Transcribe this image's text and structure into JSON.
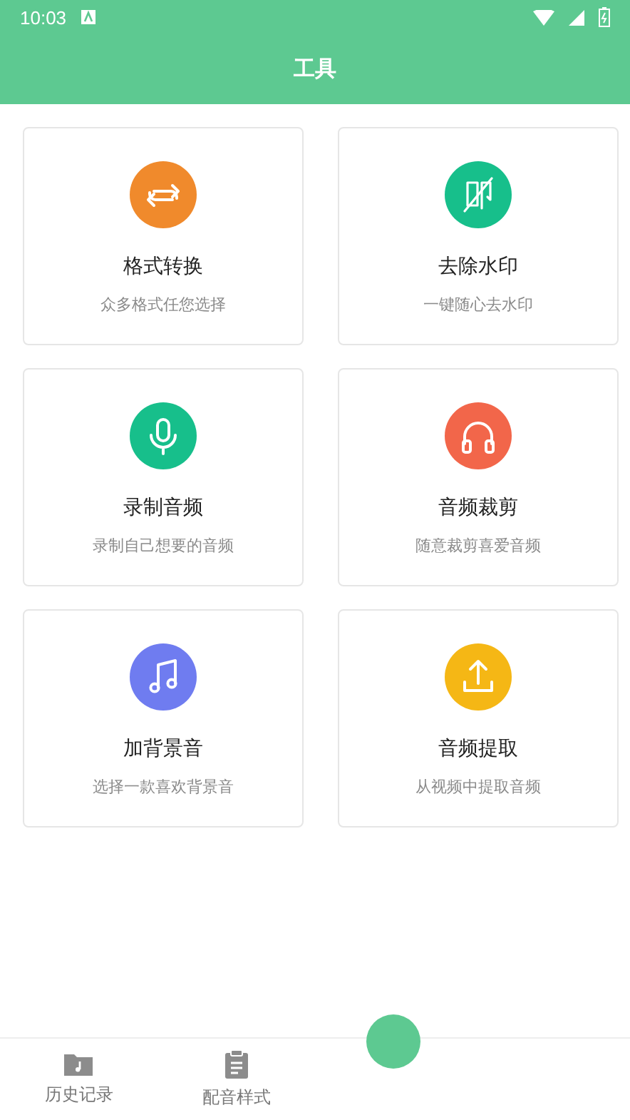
{
  "status_bar": {
    "time": "10:03"
  },
  "header": {
    "title": "工具"
  },
  "tools": [
    {
      "kind": "convert",
      "title": "格式转换",
      "subtitle": "众多格式任您选择",
      "color": "#f08a2c"
    },
    {
      "kind": "watermark",
      "title": "去除水印",
      "subtitle": "一键随心去水印",
      "color": "#17bf8b"
    },
    {
      "kind": "record",
      "title": "录制音频",
      "subtitle": "录制自己想要的音频",
      "color": "#17bf8b"
    },
    {
      "kind": "headphones",
      "title": "音频裁剪",
      "subtitle": "随意裁剪喜爱音频",
      "color": "#f2664a"
    },
    {
      "kind": "music",
      "title": "加背景音",
      "subtitle": "选择一款喜欢背景音",
      "color": "#6f7cf0"
    },
    {
      "kind": "upload",
      "title": "音频提取",
      "subtitle": "从视频中提取音频",
      "color": "#f5b715"
    }
  ],
  "tab_bar": [
    {
      "kind": "history",
      "label": "历史记录"
    },
    {
      "kind": "styles",
      "label": "配音样式"
    }
  ]
}
